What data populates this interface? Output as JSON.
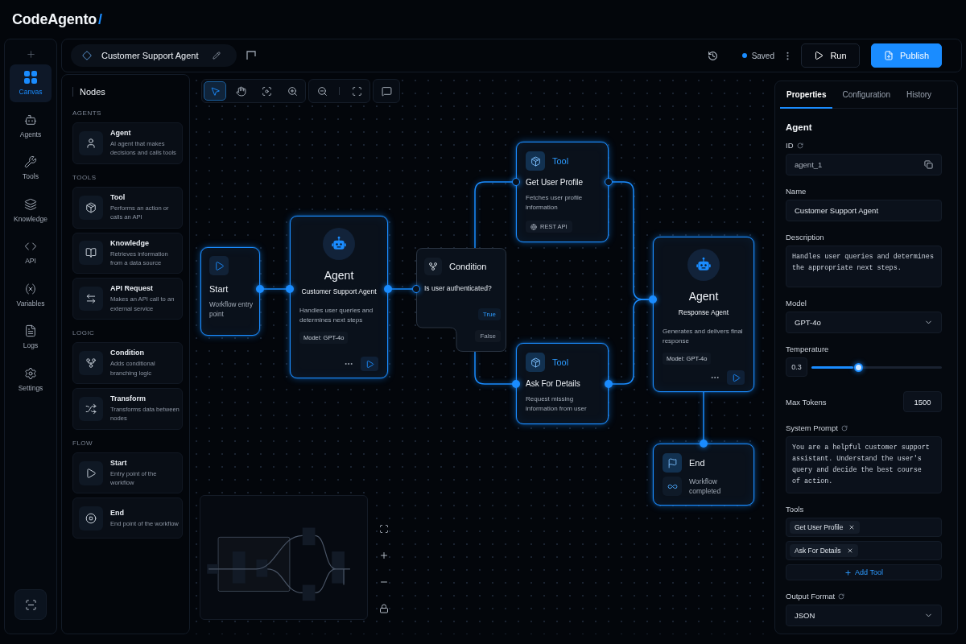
{
  "logo": {
    "name": "CodeAgento",
    "mark": "/"
  },
  "rail": {
    "items": [
      {
        "label": "Canvas",
        "selected": true
      },
      {
        "label": "Agents",
        "selected": false
      },
      {
        "label": "Tools",
        "selected": false
      },
      {
        "label": "Knowledge",
        "selected": false
      },
      {
        "label": "API",
        "selected": false
      },
      {
        "label": "Variables",
        "selected": false
      },
      {
        "label": "Logs",
        "selected": false
      },
      {
        "label": "Settings",
        "selected": false
      }
    ]
  },
  "header": {
    "title": "Customer Support Agent",
    "status": "Saved",
    "buttons": [
      {
        "label": "Run",
        "kind": "secondary"
      },
      {
        "label": "Publish",
        "kind": "primary"
      }
    ]
  },
  "nodes_panel": {
    "title": "Nodes",
    "sections": [
      {
        "heading": "AGENTS",
        "items": [
          {
            "kind": "agent",
            "title": "Agent",
            "description": "AI agent that makes decisions and calls tools"
          }
        ]
      },
      {
        "heading": "TOOLS",
        "items": [
          {
            "kind": "tool",
            "title": "Tool",
            "description": "Performs an action or calls an API"
          },
          {
            "kind": "knowledge",
            "title": "Knowledge",
            "description": "Retrieves information from a data source"
          },
          {
            "kind": "api",
            "title": "API Request",
            "description": "Makes an API call to an external service"
          }
        ]
      },
      {
        "heading": "LOGIC",
        "items": [
          {
            "kind": "condition",
            "title": "Condition",
            "description": "Adds conditional branching logic"
          },
          {
            "kind": "transform",
            "title": "Transform",
            "description": "Transforms data between nodes"
          }
        ]
      },
      {
        "heading": "FLOW",
        "items": [
          {
            "kind": "start",
            "title": "Start",
            "description": "Entry point of the workflow"
          },
          {
            "kind": "end",
            "title": "End",
            "description": "End point of the workflow"
          }
        ]
      }
    ]
  },
  "canvas": {
    "toolbar": [
      {
        "selected": true
      },
      {
        "selected": false
      },
      {
        "selected": false
      },
      {
        "selected": false
      },
      {
        "selected": false
      },
      {
        "selected": false
      },
      {
        "selected": false
      }
    ],
    "nodes": [
      {
        "kind": "start",
        "title": "Start",
        "description": "Workflow entry point"
      },
      {
        "kind": "agent",
        "title": "Agent",
        "name": "Customer Support Agent",
        "description": "Handles user queries and determines next steps",
        "model": "Model: GPT-4o"
      },
      {
        "kind": "condition",
        "title": "Condition",
        "question": "Is user authenticated?",
        "branches": [
          {
            "label": "True",
            "kind": "positive"
          },
          {
            "label": "False",
            "kind": "negative"
          }
        ]
      },
      {
        "kind": "tool",
        "category": "Tool",
        "title": "Get User Profile",
        "description": "Fetches user profile information",
        "badge": "REST API"
      },
      {
        "kind": "tool",
        "category": "Tool",
        "title": "Ask For Details",
        "description": "Request missing information from user"
      },
      {
        "kind": "agent",
        "title": "Agent",
        "name": "Response Agent",
        "description": "Generates and delivers final response",
        "model": "Model: GPT-4o"
      },
      {
        "kind": "end",
        "title": "End",
        "description": "Workflow completed"
      }
    ]
  },
  "properties": {
    "tabs": [
      {
        "label": "Properties",
        "selected": true
      },
      {
        "label": "Configuration",
        "selected": false
      },
      {
        "label": "History",
        "selected": false
      }
    ],
    "heading": "Agent",
    "fields": [
      {
        "kind": "readonly",
        "label": "ID",
        "help": true,
        "value": "agent_1"
      },
      {
        "kind": "text",
        "label": "Name",
        "help": false,
        "value": "Customer Support Agent"
      },
      {
        "kind": "textarea",
        "label": "Description",
        "help": false,
        "value": "Handles user queries and determines the appropriate next steps."
      },
      {
        "kind": "select",
        "label": "Model",
        "help": false,
        "value": "GPT-4o"
      },
      {
        "kind": "slider",
        "label": "Temperature",
        "help": false,
        "value": "0.3",
        "level": 0.36
      },
      {
        "kind": "number",
        "label": "Max Tokens",
        "help": false,
        "value": "1500"
      },
      {
        "kind": "textarea",
        "label": "System Prompt",
        "help": true,
        "value": "You are a helpful customer support assistant. Understand the user's query and decide the best course of action."
      },
      {
        "kind": "tags",
        "label": "Tools",
        "help": false,
        "tags": [
          "Get User Profile",
          "Ask For Details"
        ],
        "action": "Add Tool"
      },
      {
        "kind": "select",
        "label": "Output Format",
        "help": true,
        "value": "JSON"
      }
    ]
  }
}
